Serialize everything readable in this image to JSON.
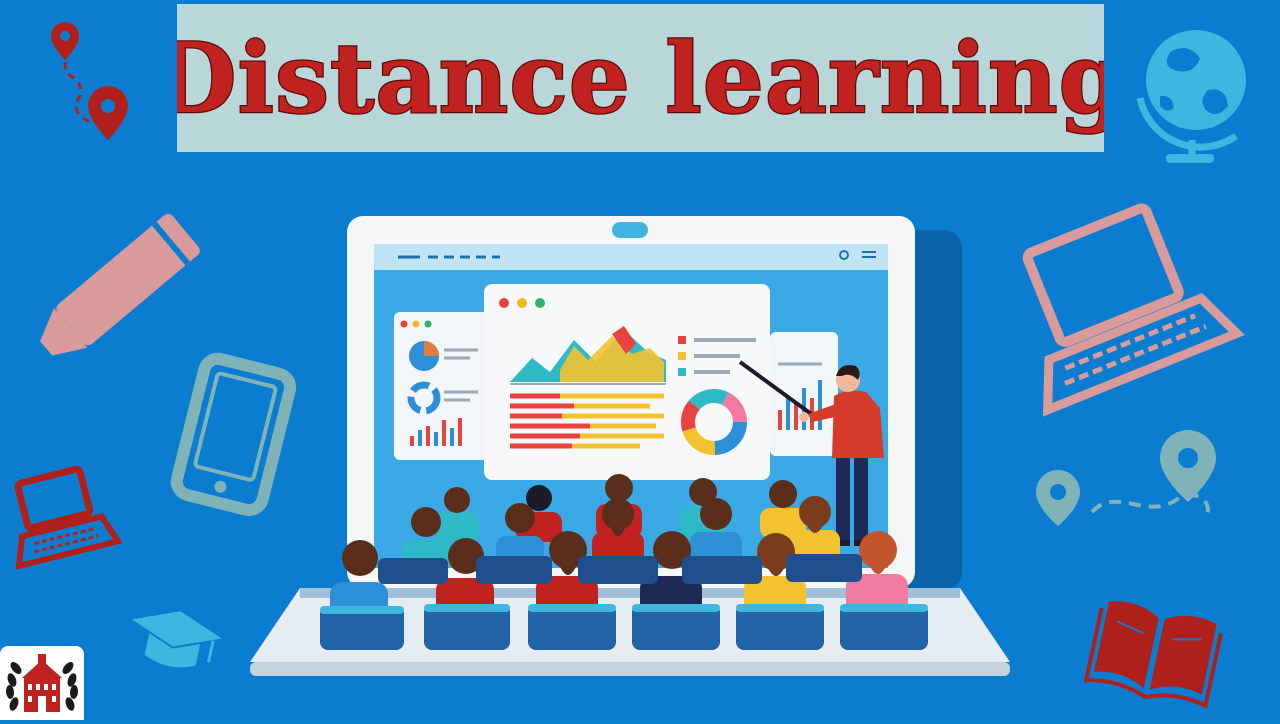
{
  "title": "Distance learning",
  "colors": {
    "background": "#0a7dd0",
    "banner": "#b9d6d8",
    "title_fill": "#b81d1d",
    "title_outline": "#5a0a0a",
    "icon_pink": "#d89a9a",
    "icon_teal": "#7fb3b8",
    "icon_darkred": "#b0201a",
    "icon_cyan": "#3fb6e0"
  },
  "decor": {
    "left": [
      "map-pin-route-icon",
      "pencil-icon",
      "smartphone-icon",
      "laptop-icon",
      "graduation-cap-icon"
    ],
    "right": [
      "globe-icon",
      "laptop-icon",
      "map-pin-route-icon",
      "open-book-icon"
    ],
    "logo": "university-emblem"
  }
}
